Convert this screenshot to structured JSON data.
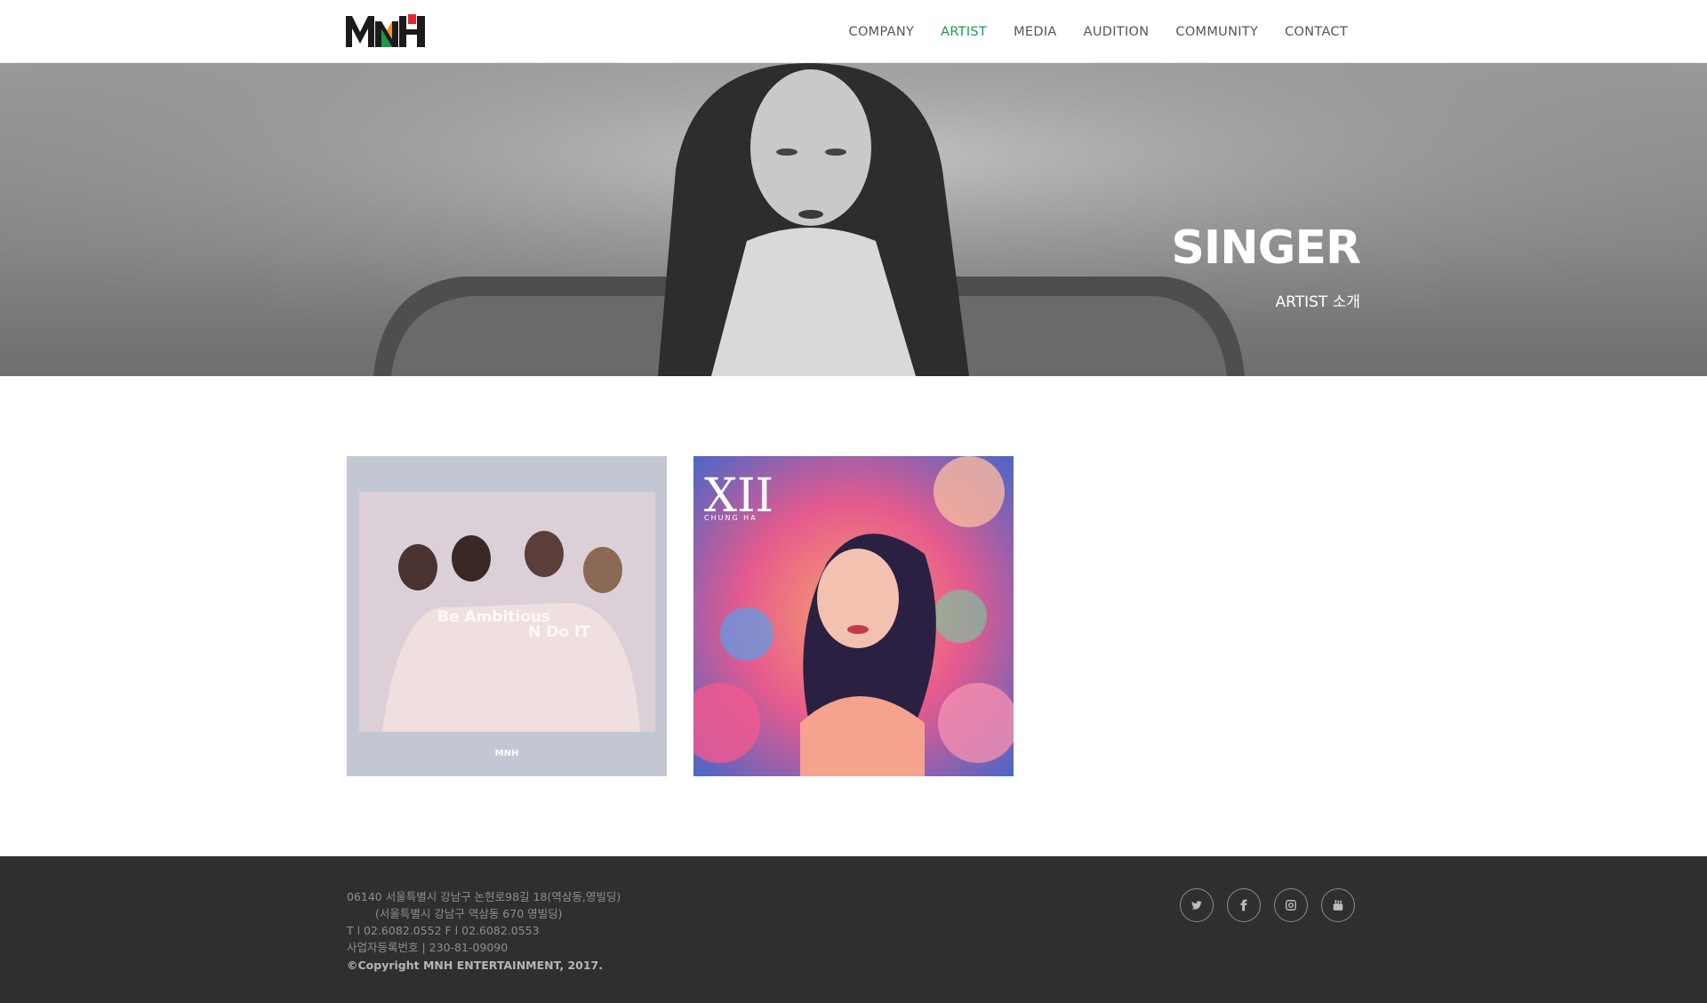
{
  "brand": {
    "logo_text": "MNH",
    "accent_green": "#1a9a4a",
    "accent_red": "#e3262e",
    "accent_orange": "#f39a1b"
  },
  "nav": {
    "items": [
      {
        "label": "COMPANY"
      },
      {
        "label": "ARTIST",
        "active": true
      },
      {
        "label": "MEDIA"
      },
      {
        "label": "AUDITION"
      },
      {
        "label": "COMMUNITY"
      },
      {
        "label": "CONTACT"
      }
    ]
  },
  "hero": {
    "title": "SINGER",
    "subtitle": "ARTIST 소개"
  },
  "artists": [
    {
      "cover_text_1": "Be Ambitious",
      "cover_text_2": "N Do IT",
      "cover_logo": "MNH"
    },
    {
      "cover_text_1": "XII",
      "cover_text_2": "CHUNG HA"
    }
  ],
  "footer": {
    "address": "06140  서울특별시 강남구 논현로98길 18(역삼동,영빌딩)",
    "address_old": "(서울특별시 강남구 역삼동 670 영빌딩)",
    "phone_fax": "T l 02.6082.0552     F l 02.6082.0553",
    "biz_number": "사업자등록번호 | 230-81-09090",
    "copyright": "©Copyright MNH ENTERTAINMENT, 2017."
  },
  "social": [
    {
      "icon": "twitter-icon"
    },
    {
      "icon": "facebook-icon"
    },
    {
      "icon": "instagram-icon"
    },
    {
      "icon": "youtube-icon"
    }
  ]
}
